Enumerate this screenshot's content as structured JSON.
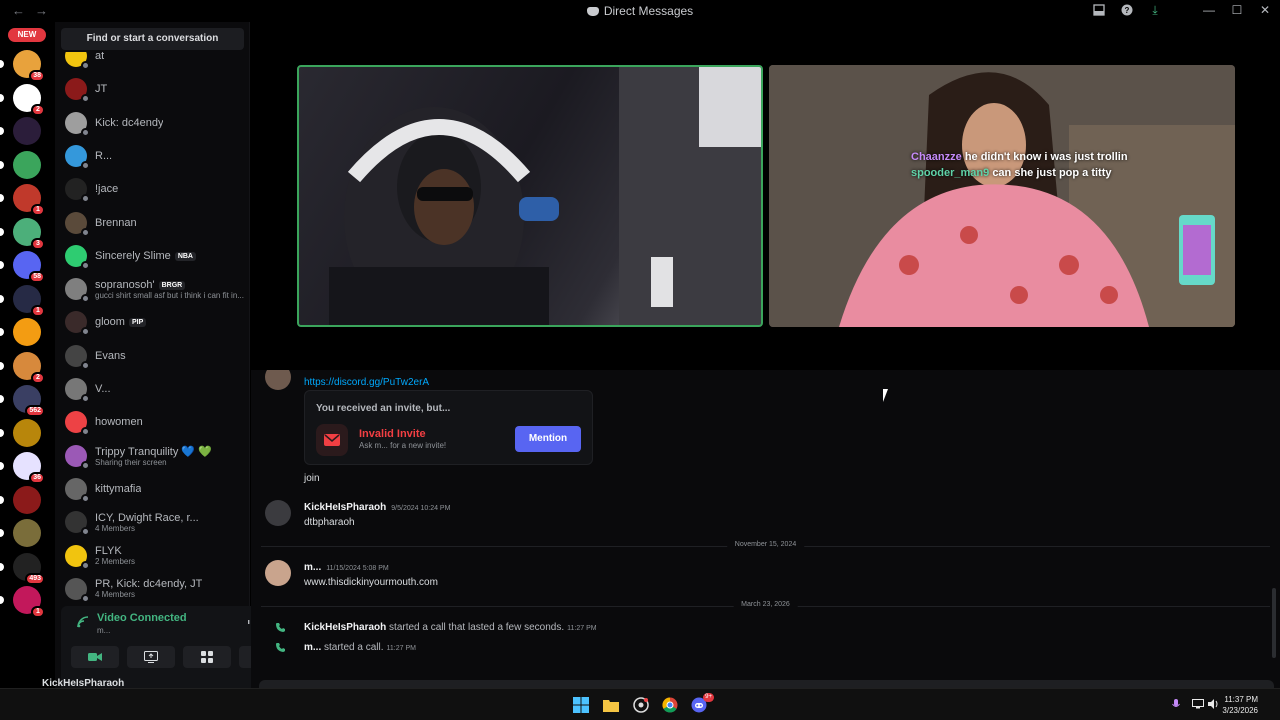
{
  "window": {
    "title": "Direct Messages",
    "back_icon": "arrow-left",
    "forward_icon": "arrow-right"
  },
  "rail": {
    "new_badge": "NEW",
    "servers": [
      {
        "color": "#e8a23c",
        "badge": "38"
      },
      {
        "color": "#ffffff",
        "badge": "2"
      },
      {
        "color": "#2b1d3a",
        "badge": ""
      },
      {
        "color": "#3ba55c",
        "badge": ""
      },
      {
        "color": "#c0392b",
        "badge": "1"
      },
      {
        "color": "#4caf7a",
        "badge": "3"
      },
      {
        "color": "#5865f2",
        "badge": "58"
      },
      {
        "color": "#262a45",
        "badge": "1"
      },
      {
        "color": "#f39c12",
        "badge": ""
      },
      {
        "color": "#d7893c",
        "badge": "2"
      },
      {
        "color": "#3a3f63",
        "badge": "562"
      },
      {
        "color": "#b8860b",
        "badge": ""
      },
      {
        "color": "#e6e2ff",
        "badge": "36"
      },
      {
        "color": "#8b1a1a",
        "badge": ""
      },
      {
        "color": "#7a6d3a",
        "badge": ""
      },
      {
        "color": "#222222",
        "badge": "493"
      },
      {
        "color": "#c2185b",
        "badge": "1"
      }
    ]
  },
  "sidebar": {
    "search_label": "Find or start a conversation",
    "dms": [
      {
        "name": "at",
        "sub": "",
        "color": "#f1c40f",
        "tag": ""
      },
      {
        "name": "JT",
        "sub": "",
        "color": "#8b1a1a",
        "tag": ""
      },
      {
        "name": "Kick: dc4endy",
        "sub": "",
        "color": "#9e9e9e",
        "tag": ""
      },
      {
        "name": "R...",
        "sub": "",
        "color": "#3498db",
        "tag": ""
      },
      {
        "name": "!jace",
        "sub": "",
        "color": "#222",
        "tag": ""
      },
      {
        "name": "Brennan",
        "sub": "",
        "color": "#5a4a3a",
        "tag": ""
      },
      {
        "name": "Sincerely Slime",
        "sub": "",
        "color": "#2ecc71",
        "tag": "NBA"
      },
      {
        "name": "sopranosoh'",
        "sub": "gucci shirt small asf but i think i can fit in...",
        "color": "#7f7f7f",
        "tag": "BRGR"
      },
      {
        "name": "gloom",
        "sub": "",
        "color": "#3a2a2a",
        "tag": "PIP"
      },
      {
        "name": "Evans",
        "sub": "",
        "color": "#444",
        "tag": ""
      },
      {
        "name": "V...",
        "sub": "",
        "color": "#777",
        "tag": ""
      },
      {
        "name": "howomen",
        "sub": "",
        "color": "#ed4245",
        "tag": ""
      },
      {
        "name": "Trippy Tranquility 💙 💚",
        "sub": "Sharing their screen",
        "color": "#9b59b6",
        "tag": ""
      },
      {
        "name": "kittymafia",
        "sub": "",
        "color": "#666",
        "tag": ""
      },
      {
        "name": "ICY, Dwight Race, r...",
        "sub": "4 Members",
        "color": "#333",
        "tag": ""
      },
      {
        "name": "FLYK",
        "sub": "2 Members",
        "color": "#f1c40f",
        "tag": ""
      },
      {
        "name": "PR, Kick: dc4endy, JT",
        "sub": "4 Members",
        "color": "#555",
        "tag": ""
      }
    ]
  },
  "voice": {
    "status": "Video Connected",
    "sub": "m..."
  },
  "userbar": {
    "name": "KickHeIsPharaoh"
  },
  "stage": {
    "overlay_line1_user": "Chaanzze",
    "overlay_line1_text": "he didn't know i was just trollin",
    "overlay_line2_user": "spooder_man9",
    "overlay_line2_text": "can she just pop a titty"
  },
  "chat": {
    "link": "https://discord.gg/PuTw2erA",
    "invite_header": "You received an invite, but...",
    "invite_title": "Invalid Invite",
    "invite_sub": "Ask m... for a new invite!",
    "mention_button": "Mention",
    "join_text": "join",
    "msg1_author": "KickHeIsPharaoh",
    "msg1_time": "9/5/2024 10:24 PM",
    "msg1_text": "dtbpharaoh",
    "date1": "November 15, 2024",
    "msg2_author": "m...",
    "msg2_time": "11/15/2024 5:08 PM",
    "msg2_text": "www.thisdickinyourmouth.com",
    "date2": "March 23, 2026",
    "call1_author": "KickHeIsPharaoh",
    "call1_text": "started a call that lasted a few seconds.",
    "call1_time": "11:27 PM",
    "call2_author": "m...",
    "call2_text": "started a call.",
    "call2_time": "11:27 PM"
  },
  "taskbar": {
    "time": "11:37 PM",
    "date": "3/23/2026",
    "discord_badge": "9+"
  }
}
